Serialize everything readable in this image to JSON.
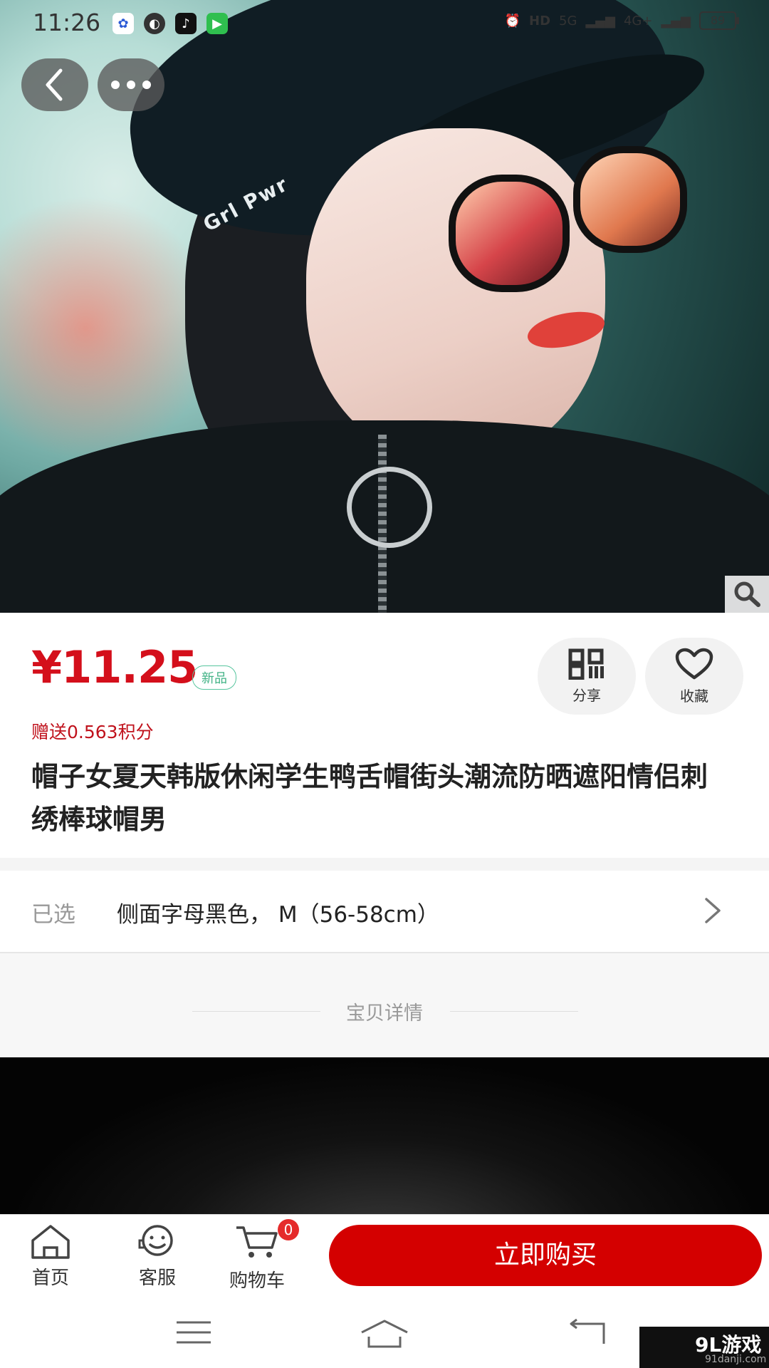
{
  "status_bar": {
    "time": "11:26",
    "network_hd": "HD",
    "network_5g": "5G",
    "network_4g": "4G+",
    "battery": "89"
  },
  "hero": {
    "cap_text": "Grl Pwr",
    "accent_color": "#d40f1b"
  },
  "product": {
    "price": "¥11.25",
    "tag": "新品",
    "points": "赠送0.563积分",
    "title": "帽子女夏天韩版休闲学生鸭舌帽街头潮流防晒遮阳情侣刺绣棒球帽男",
    "share_label": "分享",
    "favorite_label": "收藏"
  },
  "selection": {
    "label": "已选",
    "value": "侧面字母黑色， M（56-58cm）"
  },
  "details": {
    "section_title": "宝贝详情"
  },
  "bottom_bar": {
    "home_label": "首页",
    "service_label": "客服",
    "cart_label": "购物车",
    "cart_count": "0",
    "buy_label": "立即购买"
  },
  "watermark": {
    "logo": "9L游戏",
    "url": "91danji.com"
  }
}
